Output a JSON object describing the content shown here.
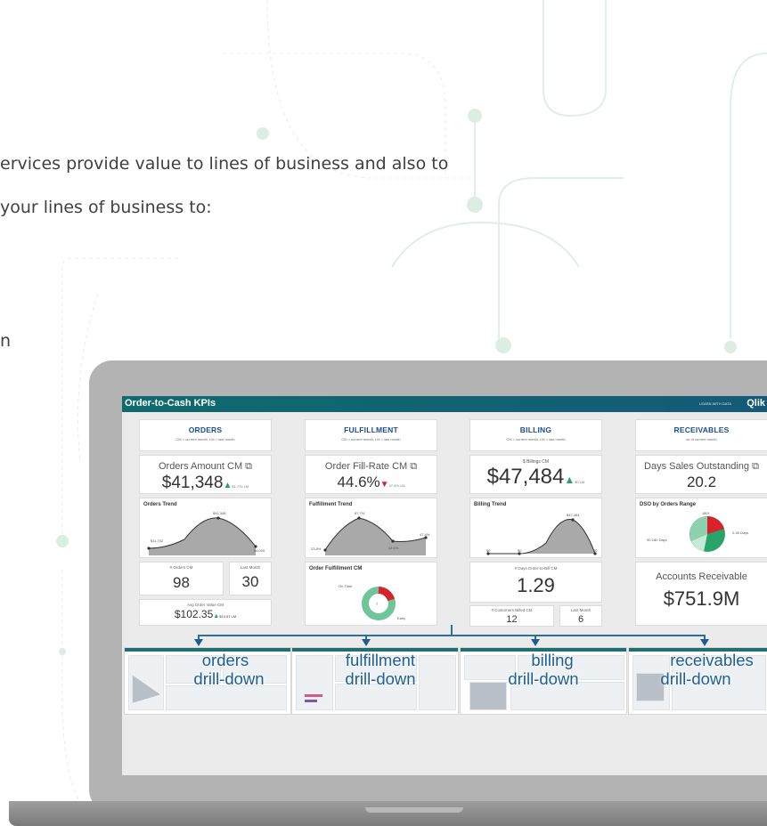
{
  "intro": {
    "line1": "ervices provide value to lines of business and also to",
    "line2": "your lines of business to:",
    "line3": "n"
  },
  "app": {
    "title": "Order-to-Cash KPIs",
    "learn": "LEARN WITH DATA",
    "logo": "Qlik"
  },
  "sections": [
    {
      "title": "ORDERS",
      "sub": "CM = current month, LM = last month"
    },
    {
      "title": "FULFILLMENT",
      "sub": "CM = current month, LM = last month"
    },
    {
      "title": "BILLING",
      "sub": "CM = current month, LM = last month"
    },
    {
      "title": "RECEIVABLES",
      "sub": "as of current month"
    }
  ],
  "kpis": {
    "orders_amount": {
      "label": "Orders Amount CM",
      "value": "$41,348",
      "lm": "$1,774 LM"
    },
    "fill_rate": {
      "label": "Order Fill-Rate CM",
      "value": "44.6%",
      "lm": "47.4% LM"
    },
    "billings": {
      "label": "$ Billings CM",
      "value": "$47,484",
      "lm": "$0 LM"
    },
    "dso": {
      "label": "Days Sales Outstanding",
      "value": "20.2"
    }
  },
  "trends": {
    "orders": {
      "title": "Orders Trend",
      "labels": [
        "$11,702",
        "$41,348",
        "$4,000"
      ]
    },
    "fulfillment": {
      "title": "Fulfillment Trend",
      "labels": [
        "23.8%",
        "87.7%",
        "44.6%",
        "47.4%"
      ]
    },
    "billing": {
      "title": "Billing Trend",
      "labels": [
        "$0",
        "$0",
        "$47,484",
        "$0"
      ]
    },
    "dso_range": {
      "title": "DSO by Orders Range",
      "labels": [
        "180+",
        "90-180 Days",
        "0-30 Days"
      ]
    }
  },
  "orders": {
    "count_label": "# Orders CM",
    "count": "98",
    "last_label": "Last Month",
    "last": "30",
    "avg_label": "Avg Order Value CM",
    "avg": "$102.35",
    "avg_lm": "$13.57 LM"
  },
  "fulfillment": {
    "title": "Order Fulfillment CM",
    "ontime": "On-Time",
    "early": "Early",
    "center": "7"
  },
  "billing": {
    "days_label": "# Days Order-to-Bill CM",
    "days": "1.29",
    "cust_label": "# Customers Billed CM",
    "cust": "12",
    "last_label": "Last Month",
    "last": "6"
  },
  "receivables": {
    "label": "Accounts Receivable",
    "value": "$751.9M"
  },
  "drilldowns": [
    {
      "line1": "orders",
      "line2": "drill-down"
    },
    {
      "line1": "fulfillment",
      "line2": "drill-down"
    },
    {
      "line1": "billing",
      "line2": "drill-down"
    },
    {
      "line1": "receivables",
      "line2": "drill-down"
    }
  ],
  "colors": {
    "accent": "#1d4e8c",
    "up": "#2aa36a",
    "down": "#d9222b",
    "pie": "#2aa36a"
  }
}
